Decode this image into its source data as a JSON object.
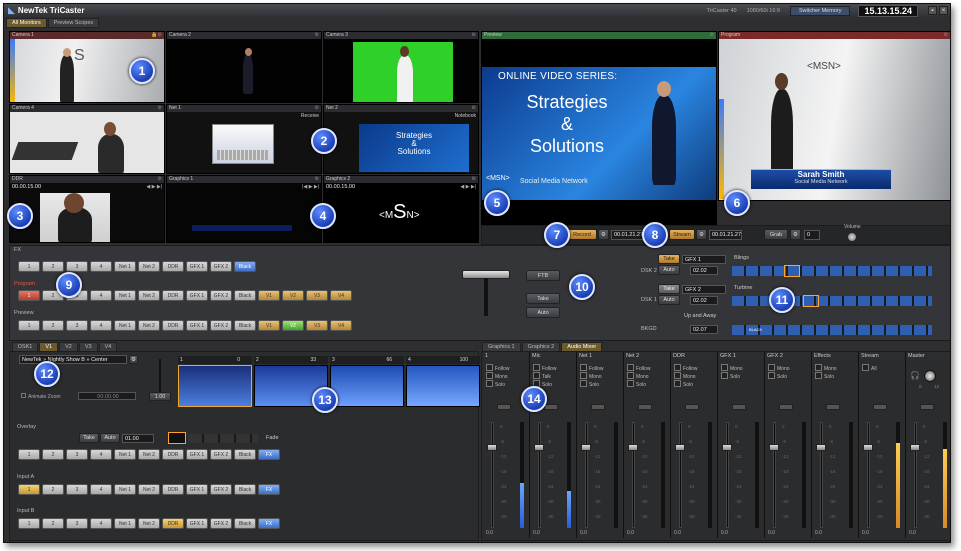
{
  "app": {
    "title": "NewTek TriCaster",
    "system": "TriCaster 40",
    "format": "1080/60i 16:9",
    "switcher_memory": "Switcher Memory",
    "clock": "15.13.15.24"
  },
  "tabs": [
    {
      "label": "All Monitors"
    },
    {
      "label": "Preview Scopes"
    }
  ],
  "monitors": {
    "camera1": "Camera 1",
    "camera2": "Camera 2",
    "camera3": "Camera 3",
    "camera4": "Camera 4",
    "net1": "Net 1",
    "net2": "Net 2",
    "ddr": "DDR",
    "graphics1": "Graphics 1",
    "graphics2": "Graphics 2",
    "preview": "Preview",
    "program": "Program",
    "net1_source": "Receive",
    "net2_source": "Notebook",
    "ddr_time": "00.00.15.00",
    "graphics2_time": "00.00.15.00"
  },
  "preview_content": {
    "series": "ONLINE VIDEO SERIES:",
    "title1": "Strategies",
    "title2": "&",
    "title3": "Solutions",
    "network": "Social Media Network",
    "logo": "<MSN>"
  },
  "program_content": {
    "name": "Sarah Smith",
    "role": "Social Media Network",
    "wall_logo": "<MSN>"
  },
  "net2_content": {
    "line1": "Strategies",
    "line2": "&",
    "line3": "Solutions"
  },
  "graphics2_content": {
    "logo_left": "<M",
    "logo_mid": "S",
    "logo_right": "N>"
  },
  "record": {
    "label": "Record",
    "time": "00.01.21.27"
  },
  "stream": {
    "label": "Stream",
    "time": "00.01.21.27"
  },
  "grab": {
    "label": "Grab",
    "count": "0"
  },
  "volume": {
    "label": "Volume"
  },
  "switcher": {
    "fx_label": "FX",
    "program_label": "Program",
    "preview_label": "Preview",
    "row1": [
      "1",
      "2",
      "3",
      "4",
      "Net 1",
      "Net 2",
      "DDR",
      "GFX 1",
      "GFX 2",
      "Black"
    ],
    "row2": [
      "1",
      "2",
      "3",
      "4",
      "Net 1",
      "Net 2",
      "DDR",
      "GFX 1",
      "GFX 2",
      "Black",
      "V1",
      "V2",
      "V3",
      "V4"
    ],
    "row3": [
      "1",
      "2",
      "3",
      "4",
      "Net 1",
      "Net 2",
      "DDR",
      "GFX 1",
      "GFX 2",
      "Black",
      "V1",
      "V2",
      "V3",
      "V4"
    ],
    "ftb": "FTB",
    "take": "Take",
    "auto": "Auto"
  },
  "dsk2": {
    "label": "DSK 2",
    "take": "Take",
    "auto": "Auto",
    "source": "GFX 1",
    "rate": "02.02",
    "transition": "Blings"
  },
  "dsk1": {
    "label": "DSK 1",
    "take": "Take",
    "auto": "Auto",
    "source": "GFX 2",
    "rate": "02.02",
    "transition": "Turbine"
  },
  "bkgd": {
    "label": "BKGD",
    "transition": "Up and Away",
    "rate": "02.07",
    "black": "BLACK"
  },
  "lower_tabs": [
    {
      "label": "DSK1"
    },
    {
      "label": "V1"
    },
    {
      "label": "V2"
    },
    {
      "label": "V3"
    },
    {
      "label": "V4"
    }
  ],
  "virtual_set": {
    "path": "NewTek  »  Nightly Show B  »  Center",
    "animate_zoom": "Animate Zoom",
    "zoom_time": "00.00.00",
    "slider_value": "1.00",
    "thumbs": [
      {
        "num": "1",
        "val": "0"
      },
      {
        "num": "2",
        "val": "33"
      },
      {
        "num": "3",
        "val": "66"
      },
      {
        "num": "4",
        "val": "100"
      }
    ]
  },
  "overlay": {
    "label": "Overlay",
    "take": "Take",
    "auto": "Auto",
    "rate": "01.00",
    "transition": "Fade",
    "row": [
      "1",
      "2",
      "3",
      "4",
      "Net 1",
      "Net 2",
      "DDR",
      "GFX 1",
      "GFX 2",
      "Black",
      "FX"
    ]
  },
  "inputA": {
    "label": "Input A",
    "row": [
      "1",
      "2",
      "3",
      "4",
      "Net 1",
      "Net 2",
      "DDR",
      "GFX 1",
      "GFX 2",
      "Black",
      "FX"
    ]
  },
  "inputB": {
    "label": "Input B",
    "row": [
      "1",
      "2",
      "3",
      "4",
      "Net 1",
      "Net 2",
      "DDR",
      "GFX 1",
      "GFX 2",
      "Black",
      "FX"
    ]
  },
  "mixer_tabs": [
    {
      "label": "Graphics 1"
    },
    {
      "label": "Graphics 2"
    },
    {
      "label": "Audio Mixer"
    }
  ],
  "mixer": {
    "channels": [
      {
        "name": "1",
        "opts": [
          "Follow",
          "Mono",
          "Solo"
        ],
        "val": "0.0"
      },
      {
        "name": "Mic",
        "opts": [
          "Follow",
          "Talk",
          "Solo"
        ],
        "val": "0.0"
      },
      {
        "name": "Net 1",
        "opts": [
          "Follow",
          "Mono",
          "Solo"
        ],
        "val": "0.0"
      },
      {
        "name": "Net 2",
        "opts": [
          "Follow",
          "Mono",
          "Solo"
        ],
        "val": "0.0"
      },
      {
        "name": "DDR",
        "opts": [
          "Follow",
          "Mono",
          "Solo"
        ],
        "val": "0.0"
      },
      {
        "name": "GFX 1",
        "opts": [
          "Mono",
          "Solo"
        ],
        "val": "0.0"
      },
      {
        "name": "GFX 2",
        "opts": [
          "Mono",
          "Solo"
        ],
        "val": "0.0"
      },
      {
        "name": "Effects",
        "opts": [
          "Mono",
          "Solo"
        ],
        "val": "0.0"
      },
      {
        "name": "Stream",
        "opts": [
          "All"
        ],
        "val": "0.0"
      },
      {
        "name": "Master",
        "opts": [],
        "val": "0.0"
      }
    ],
    "scale": [
      "0",
      "-6",
      "-12",
      "-18",
      "-24",
      "-30",
      "-40"
    ],
    "knob_range_lo": "0",
    "knob_range_hi": "12"
  },
  "callouts": [
    "1",
    "2",
    "3",
    "4",
    "5",
    "6",
    "7",
    "8",
    "9",
    "10",
    "11",
    "12",
    "13",
    "14"
  ]
}
